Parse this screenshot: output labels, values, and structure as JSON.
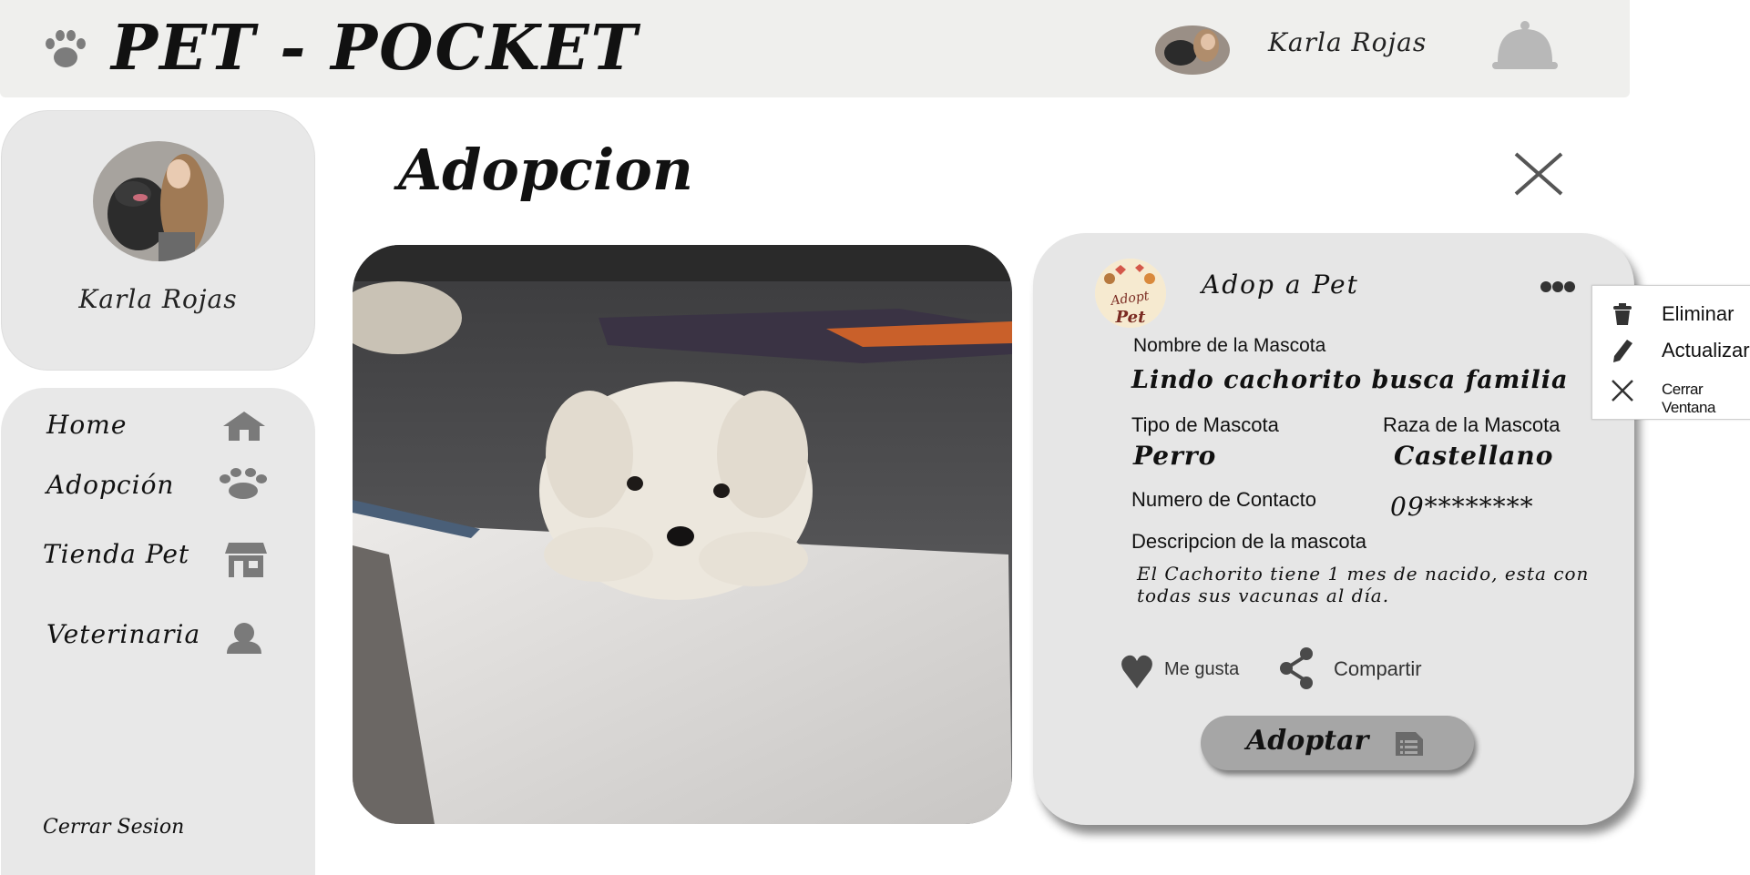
{
  "app": {
    "brand": "PET - POCKET",
    "user_name": "Karla Rojas"
  },
  "sidebar": {
    "profile_name": "Karla Rojas",
    "items": [
      {
        "label": "Home",
        "icon": "home-icon"
      },
      {
        "label": "Adopción",
        "icon": "paw-icon"
      },
      {
        "label": "Tienda Pet",
        "icon": "store-icon"
      },
      {
        "label": "Veterinaria",
        "icon": "person-icon"
      }
    ],
    "logout_label": "Cerrar Sesion"
  },
  "main": {
    "title": "Adopcion"
  },
  "post": {
    "org_name": "Adop a Pet",
    "org_logo_text": "Adopt a Pet",
    "pet_name_label": "Nombre de la Mascota",
    "pet_name": "Lindo cachorito busca familia",
    "type_label": "Tipo de Mascota",
    "type_value": "Perro",
    "breed_label": "Raza de la Mascota",
    "breed_value": "Castellano",
    "contact_label": "Numero de Contacto",
    "contact_value": "09********",
    "description_label": "Descripcion de la mascota",
    "description": "El Cachorito tiene 1 mes de nacido, esta con todas sus vacunas al día.",
    "like_label": "Me gusta",
    "share_label": "Compartir",
    "adopt_label": "Adoptar"
  },
  "context_menu": {
    "items": [
      {
        "label": "Eliminar",
        "icon": "trash-icon"
      },
      {
        "label": "Actualizar",
        "icon": "pencil-icon"
      },
      {
        "label": "Cerrar Ventana",
        "icon": "close-icon"
      }
    ]
  },
  "colors": {
    "topbar_bg": "#efefed",
    "card_bg": "#e8e8e8",
    "icon_gray": "#777777",
    "button_gray": "#a6a6a6"
  }
}
